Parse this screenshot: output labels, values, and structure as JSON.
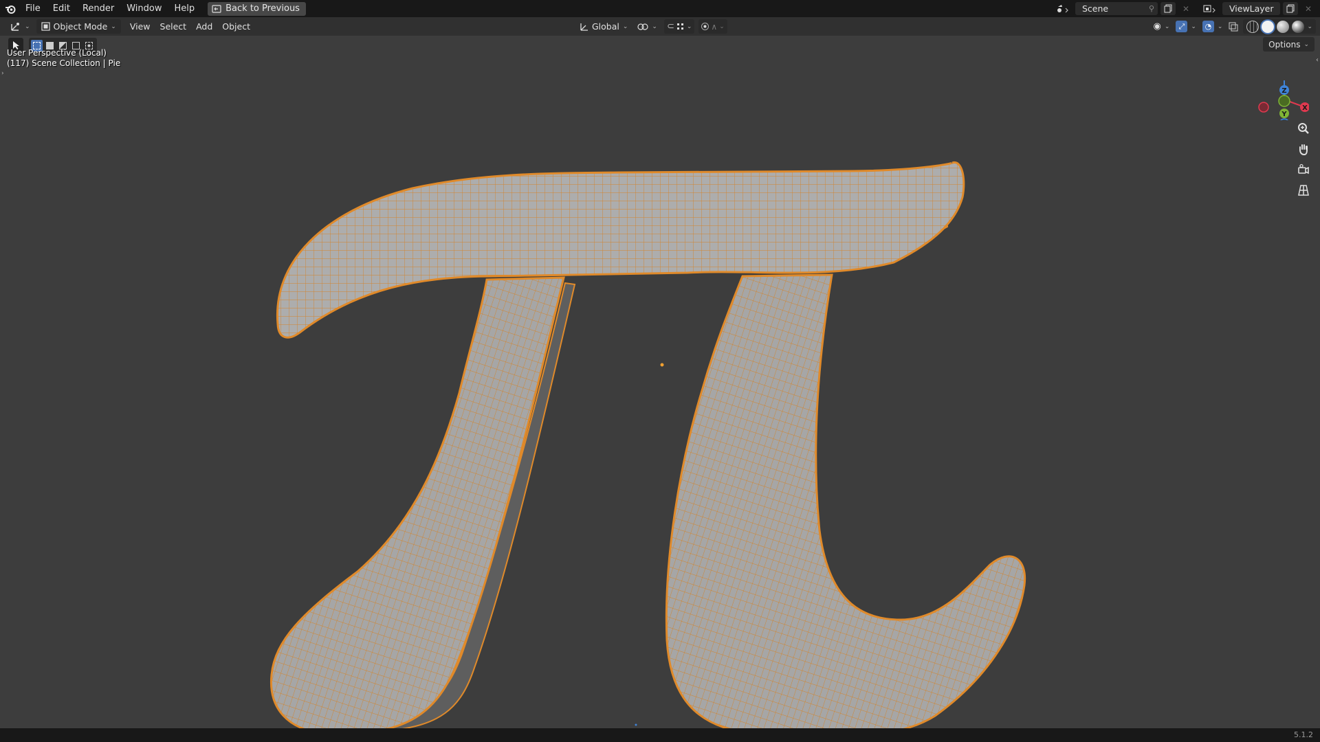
{
  "topbar": {
    "menu": [
      "File",
      "Edit",
      "Render",
      "Window",
      "Help"
    ],
    "back_label": "Back to Previous",
    "scene_name": "Scene",
    "view_layer": "ViewLayer"
  },
  "header": {
    "mode": "Object Mode",
    "menus": [
      "View",
      "Select",
      "Add",
      "Object"
    ],
    "transform_orientation": "Global",
    "options_label": "Options"
  },
  "viewport": {
    "view_name": "User Perspective (Local)",
    "collection_info": "(117) Scene Collection | Pie",
    "gizmo_axes": {
      "x": "X",
      "y": "Y",
      "z": "Z"
    }
  },
  "status": {
    "version": "5.1.2"
  },
  "colors": {
    "accent": "#4772b3",
    "mesh_wire": "#e08a2a",
    "mesh_surface": "#adadad",
    "viewport_bg": "#3d3d3d",
    "axis_x": "#e0394f",
    "axis_y": "#7fb535",
    "axis_z": "#3f84d9"
  }
}
